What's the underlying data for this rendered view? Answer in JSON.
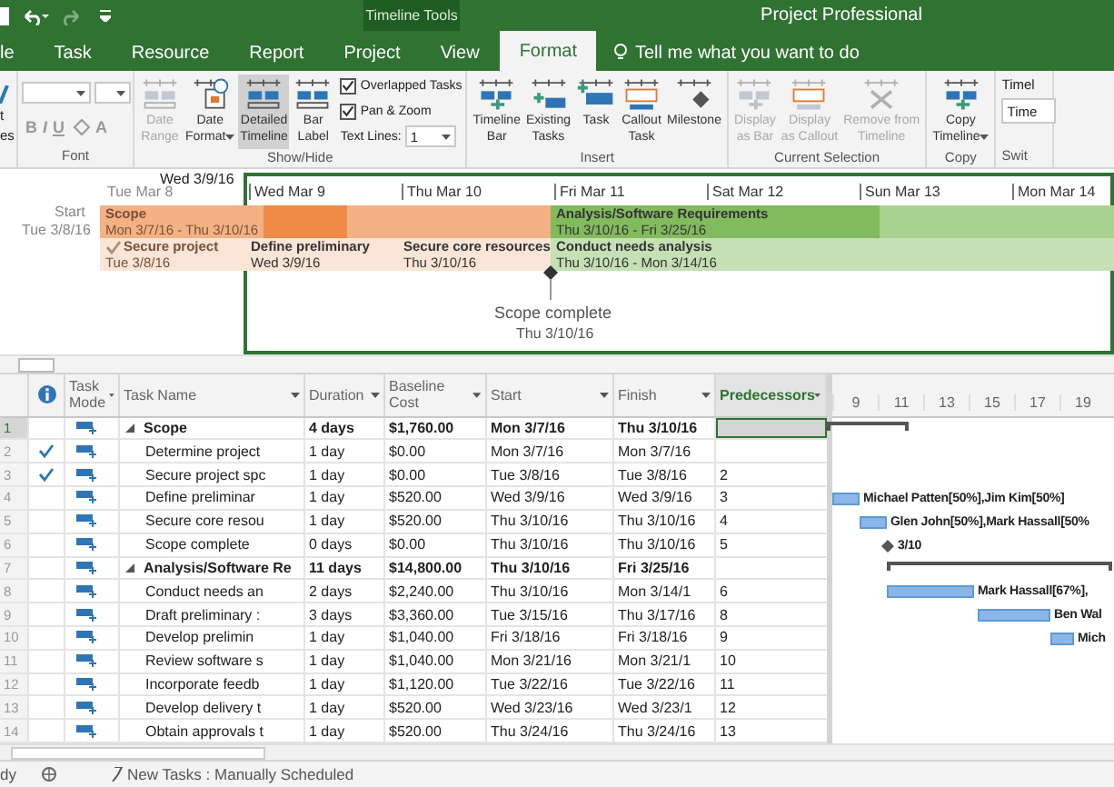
{
  "title_bar": {
    "context": "Timeline Tools",
    "title": "Project Professional"
  },
  "tabs": [
    {
      "label": "le",
      "selected": false
    },
    {
      "label": "Task",
      "selected": false
    },
    {
      "label": "Resource",
      "selected": false
    },
    {
      "label": "Report",
      "selected": false
    },
    {
      "label": "Project",
      "selected": false
    },
    {
      "label": "View",
      "selected": false
    },
    {
      "label": "Format",
      "selected": true
    }
  ],
  "tell_me": "Tell me what you want to do",
  "ribbon": {
    "cut_left": [
      "t",
      "es"
    ],
    "font": {
      "label": "Font",
      "format_glyphs": [
        "B",
        "I",
        "U"
      ],
      "font_color": "A"
    },
    "show_hide": {
      "label": "Show/Hide",
      "buttons": [
        {
          "kind": "range",
          "lines": [
            "Date",
            "Range"
          ],
          "disabled": true,
          "selected": false,
          "dropdown": false
        },
        {
          "kind": "calendar",
          "lines": [
            "Date",
            "Format"
          ],
          "disabled": false,
          "selected": false,
          "dropdown": true
        },
        {
          "kind": "detailed",
          "lines": [
            "Detailed",
            "Timeline"
          ],
          "disabled": false,
          "selected": true,
          "dropdown": false
        },
        {
          "kind": "label",
          "lines": [
            "Bar",
            "Label"
          ],
          "disabled": false,
          "selected": false,
          "dropdown": false
        }
      ],
      "checkboxes": [
        {
          "label": "Overlapped Tasks",
          "checked": true
        },
        {
          "label": "Pan & Zoom",
          "checked": true
        }
      ],
      "text_lines": {
        "label": "Text Lines:",
        "value": "1"
      }
    },
    "insert": {
      "label": "Insert",
      "buttons": [
        {
          "kind": "bar",
          "lines": [
            "Timeline",
            "Bar"
          ],
          "disabled": false,
          "selected": false,
          "dropdown": false
        },
        {
          "kind": "existing",
          "lines": [
            "Existing",
            "Tasks"
          ],
          "disabled": false,
          "selected": false,
          "dropdown": false
        },
        {
          "kind": "task",
          "lines": [
            "Task"
          ],
          "disabled": false,
          "selected": false,
          "dropdown": false
        },
        {
          "kind": "callout",
          "lines": [
            "Callout",
            "Task"
          ],
          "disabled": false,
          "selected": false,
          "dropdown": false
        },
        {
          "kind": "milestone",
          "lines": [
            "Milestone"
          ],
          "disabled": false,
          "selected": false,
          "dropdown": false
        }
      ]
    },
    "current_selection": {
      "label": "Current Selection",
      "buttons": [
        {
          "kind": "bar",
          "lines": [
            "Display",
            "as Bar"
          ],
          "disabled": true,
          "selected": false,
          "dropdown": false
        },
        {
          "kind": "callout",
          "lines": [
            "Display",
            "as Callout"
          ],
          "disabled": true,
          "selected": false,
          "dropdown": false
        },
        {
          "kind": "remove",
          "lines": [
            "Remove from",
            "Timeline"
          ],
          "disabled": true,
          "selected": false,
          "dropdown": false
        }
      ]
    },
    "copy": {
      "label": "Copy",
      "buttons": [
        {
          "kind": "copy",
          "lines": [
            "Copy",
            "Timeline"
          ],
          "disabled": false,
          "selected": false,
          "dropdown": true
        }
      ]
    },
    "switch": {
      "label": "Swit",
      "title": "Timel",
      "value": "Time"
    }
  },
  "timeline": {
    "start_label": "Start",
    "start_date": "Tue 3/8/16",
    "current": "Wed 3/9/16",
    "scale": [
      "Tue Mar 8",
      "Wed Mar 9",
      "Thu Mar 10",
      "Fri Mar 11",
      "Sat Mar 12",
      "Sun Mar 13",
      "Mon Mar 14"
    ],
    "bars": [
      {
        "name": "Scope",
        "dates": "Mon 3/7/16 - Thu 3/10/16",
        "color": "#f4b183",
        "done": false,
        "faded": true
      },
      {
        "name": "Analysis/Software Requirements",
        "dates": "Thu 3/10/16 - Fri 3/25/16",
        "color": "#a9d18e",
        "done": false,
        "faded": false
      },
      {
        "name": "Secure project",
        "dates": "Tue 3/8/16",
        "color": "#fbe5d6",
        "done": true,
        "faded": true
      },
      {
        "name": "Define preliminary",
        "dates": "Wed 3/9/16",
        "color": "#fbe5d6",
        "done": false,
        "faded": false
      },
      {
        "name": "Secure core resources",
        "dates": "Thu 3/10/16",
        "color": "#fbe5d6",
        "done": false,
        "faded": false
      },
      {
        "name": "Conduct needs analysis",
        "dates": "Thu 3/10/16 - Mon 3/14/16",
        "color": "#c5e0b4",
        "done": false,
        "faded": false
      }
    ],
    "milestone": {
      "name": "Scope complete",
      "date": "Thu 3/10/16"
    }
  },
  "table": {
    "columns": [
      {
        "label": "Task Mode",
        "selected": false
      },
      {
        "label": "Task Name",
        "selected": false
      },
      {
        "label": "Duration",
        "selected": false
      },
      {
        "label": "Baseline Cost",
        "selected": false
      },
      {
        "label": "Start",
        "selected": false
      },
      {
        "label": "Finish",
        "selected": false
      },
      {
        "label": "Predecessors",
        "selected": true
      }
    ],
    "rows": [
      {
        "id": "1",
        "kind": "summary",
        "done": false,
        "selected": true,
        "name": "Scope",
        "duration": "4 days",
        "cost": "$1,760.00",
        "start": "Mon 3/7/16",
        "finish": "Thu 3/10/16",
        "gantt": {
          "kind": "summary"
        }
      },
      {
        "id": "2",
        "kind": "task",
        "done": true,
        "selected": false,
        "name": "Determine project",
        "duration": "1 day",
        "cost": "$0.00",
        "start": "Mon 3/7/16",
        "finish": "Mon 3/7/16"
      },
      {
        "id": "3",
        "kind": "task",
        "done": true,
        "selected": false,
        "name": "Secure project spc",
        "duration": "1 day",
        "cost": "$0.00",
        "start": "Tue 3/8/16",
        "finish": "Tue 3/8/16",
        "pred": "2"
      },
      {
        "id": "4",
        "kind": "task",
        "done": false,
        "selected": false,
        "name": "Define preliminar",
        "duration": "1 day",
        "cost": "$520.00",
        "start": "Wed 3/9/16",
        "finish": "Wed 3/9/16",
        "pred": "3",
        "gantt": {
          "kind": "task",
          "label": "Michael Patten[50%],Jim Kim[50%]"
        }
      },
      {
        "id": "5",
        "kind": "task",
        "done": false,
        "selected": false,
        "name": "Secure core resou",
        "duration": "1 day",
        "cost": "$520.00",
        "start": "Thu 3/10/16",
        "finish": "Thu 3/10/16",
        "pred": "4",
        "gantt": {
          "kind": "task",
          "label": "Glen John[50%],Mark Hassall[50%"
        }
      },
      {
        "id": "6",
        "kind": "task",
        "done": false,
        "selected": false,
        "name": "Scope complete",
        "duration": "0 days",
        "cost": "$0.00",
        "start": "Thu 3/10/16",
        "finish": "Thu 3/10/16",
        "pred": "5",
        "gantt": {
          "kind": "milestone",
          "label": "3/10"
        }
      },
      {
        "id": "7",
        "kind": "summary",
        "done": false,
        "selected": false,
        "name": "Analysis/Software Re",
        "duration": "11 days",
        "cost": "$14,800.00",
        "start": "Thu 3/10/16",
        "finish": "Fri 3/25/16",
        "gantt": {
          "kind": "summary"
        }
      },
      {
        "id": "8",
        "kind": "task",
        "done": false,
        "selected": false,
        "name": "Conduct needs an",
        "duration": "2 days",
        "cost": "$2,240.00",
        "start": "Thu 3/10/16",
        "finish": "Mon 3/14/1",
        "pred": "6",
        "gantt": {
          "kind": "task",
          "label": "Mark Hassall[67%],"
        }
      },
      {
        "id": "9",
        "kind": "task",
        "done": false,
        "selected": false,
        "name": "Draft preliminary :",
        "duration": "3 days",
        "cost": "$3,360.00",
        "start": "Tue 3/15/16",
        "finish": "Thu 3/17/16",
        "pred": "8",
        "gantt": {
          "kind": "task",
          "label": "Ben Wal"
        }
      },
      {
        "id": "10",
        "kind": "task",
        "done": false,
        "selected": false,
        "name": "Develop prelimin",
        "duration": "1 day",
        "cost": "$1,040.00",
        "start": "Fri 3/18/16",
        "finish": "Fri 3/18/16",
        "pred": "9",
        "gantt": {
          "kind": "task",
          "label": "Mich"
        }
      },
      {
        "id": "11",
        "kind": "task",
        "done": false,
        "selected": false,
        "name": "Review software s",
        "duration": "1 day",
        "cost": "$1,040.00",
        "start": "Mon 3/21/16",
        "finish": "Mon 3/21/1",
        "pred": "10"
      },
      {
        "id": "12",
        "kind": "task",
        "done": false,
        "selected": false,
        "name": "Incorporate feedb",
        "duration": "1 day",
        "cost": "$1,120.00",
        "start": "Tue 3/22/16",
        "finish": "Tue 3/22/16",
        "pred": "11"
      },
      {
        "id": "13",
        "kind": "task",
        "done": false,
        "selected": false,
        "name": "Develop delivery t",
        "duration": "1 day",
        "cost": "$520.00",
        "start": "Wed 3/23/16",
        "finish": "Wed 3/23/1",
        "pred": "12"
      },
      {
        "id": "14",
        "kind": "task",
        "done": false,
        "selected": false,
        "name": "Obtain approvals t",
        "duration": "1 day",
        "cost": "$520.00",
        "start": "Thu 3/24/16",
        "finish": "Thu 3/24/16",
        "pred": "13"
      }
    ]
  },
  "gantt_scale": [
    "9",
    "11",
    "13",
    "15",
    "17",
    "19"
  ],
  "status_bar": {
    "ready": "dy",
    "mode": "New Tasks : Manually Scheduled"
  }
}
